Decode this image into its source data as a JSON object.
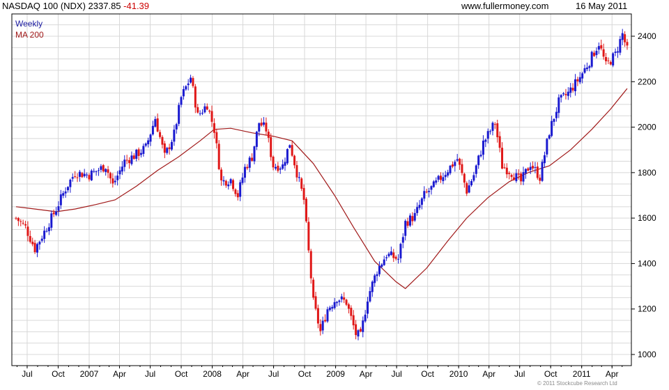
{
  "header": {
    "title": "NASDAQ 100 (NDX) 2337.85",
    "change": "-41.39",
    "website": "www.fullermoney.com",
    "date": "16 May 2011"
  },
  "legend": {
    "weekly": "Weekly",
    "ma": "MA 200"
  },
  "copyright": "© 2011 Stockcube Research Ltd",
  "colors": {
    "up": "#1a1ad0",
    "down": "#e01818",
    "ma": "#a01818",
    "grid": "#d8d8d8",
    "axis": "#000000"
  },
  "chart_data": {
    "type": "candlestick",
    "interval": "weekly",
    "x_range": [
      "2006-05-29",
      "2011-05-16"
    ],
    "ylim": [
      970,
      2450
    ],
    "y_ticks": [
      1000,
      1200,
      1400,
      1600,
      1800,
      2000,
      2200,
      2400
    ],
    "x_ticks": [
      {
        "label": "Jul",
        "date": "2006-07-01"
      },
      {
        "label": "Oct",
        "date": "2006-10-01"
      },
      {
        "label": "2007",
        "date": "2007-01-01"
      },
      {
        "label": "Apr",
        "date": "2007-04-01"
      },
      {
        "label": "Jul",
        "date": "2007-07-01"
      },
      {
        "label": "Oct",
        "date": "2007-10-01"
      },
      {
        "label": "2008",
        "date": "2008-01-01"
      },
      {
        "label": "Apr",
        "date": "2008-04-01"
      },
      {
        "label": "Jul",
        "date": "2008-07-01"
      },
      {
        "label": "Oct",
        "date": "2008-10-01"
      },
      {
        "label": "2009",
        "date": "2009-01-01"
      },
      {
        "label": "Apr",
        "date": "2009-04-01"
      },
      {
        "label": "Jul",
        "date": "2009-07-01"
      },
      {
        "label": "Oct",
        "date": "2009-10-01"
      },
      {
        "label": "2010",
        "date": "2010-01-01"
      },
      {
        "label": "Apr",
        "date": "2010-04-01"
      },
      {
        "label": "Jul",
        "date": "2010-07-01"
      },
      {
        "label": "Oct",
        "date": "2010-10-01"
      },
      {
        "label": "2011",
        "date": "2011-01-01"
      },
      {
        "label": "Apr",
        "date": "2011-04-01"
      }
    ],
    "grid": true,
    "price_path": [
      [
        "2006-05-29",
        1600
      ],
      [
        "2006-06-26",
        1560
      ],
      [
        "2006-07-24",
        1465
      ],
      [
        "2006-08-21",
        1540
      ],
      [
        "2006-09-25",
        1640
      ],
      [
        "2006-10-23",
        1730
      ],
      [
        "2006-11-20",
        1800
      ],
      [
        "2007-01-01",
        1790
      ],
      [
        "2007-02-19",
        1830
      ],
      [
        "2007-03-12",
        1745
      ],
      [
        "2007-04-16",
        1850
      ],
      [
        "2007-05-21",
        1880
      ],
      [
        "2007-06-18",
        1910
      ],
      [
        "2007-07-16",
        2040
      ],
      [
        "2007-08-13",
        1870
      ],
      [
        "2007-09-10",
        1970
      ],
      [
        "2007-10-01",
        2130
      ],
      [
        "2007-10-29",
        2220
      ],
      [
        "2007-11-19",
        2050
      ],
      [
        "2007-12-17",
        2100
      ],
      [
        "2008-01-07",
        1990
      ],
      [
        "2008-01-28",
        1760
      ],
      [
        "2008-02-25",
        1770
      ],
      [
        "2008-03-17",
        1700
      ],
      [
        "2008-04-07",
        1820
      ],
      [
        "2008-04-28",
        1870
      ],
      [
        "2008-05-19",
        2020
      ],
      [
        "2008-06-09",
        1990
      ],
      [
        "2008-06-30",
        1830
      ],
      [
        "2008-07-28",
        1830
      ],
      [
        "2008-08-18",
        1930
      ],
      [
        "2008-09-08",
        1800
      ],
      [
        "2008-09-29",
        1680
      ],
      [
        "2008-10-13",
        1450
      ],
      [
        "2008-10-27",
        1230
      ],
      [
        "2008-11-17",
        1100
      ],
      [
        "2008-12-08",
        1200
      ],
      [
        "2009-01-05",
        1250
      ],
      [
        "2009-02-02",
        1230
      ],
      [
        "2009-03-02",
        1090
      ],
      [
        "2009-03-16",
        1080
      ],
      [
        "2009-04-06",
        1250
      ],
      [
        "2009-05-04",
        1370
      ],
      [
        "2009-06-01",
        1440
      ],
      [
        "2009-07-06",
        1420
      ],
      [
        "2009-07-27",
        1580
      ],
      [
        "2009-08-24",
        1610
      ],
      [
        "2009-09-21",
        1700
      ],
      [
        "2009-10-19",
        1740
      ],
      [
        "2009-11-16",
        1790
      ],
      [
        "2009-12-28",
        1860
      ],
      [
        "2010-01-25",
        1720
      ],
      [
        "2010-02-15",
        1790
      ],
      [
        "2010-03-15",
        1930
      ],
      [
        "2010-04-19",
        2020
      ],
      [
        "2010-05-10",
        1830
      ],
      [
        "2010-06-07",
        1800
      ],
      [
        "2010-07-05",
        1760
      ],
      [
        "2010-08-02",
        1840
      ],
      [
        "2010-08-30",
        1780
      ],
      [
        "2010-09-27",
        1980
      ],
      [
        "2010-10-25",
        2110
      ],
      [
        "2010-11-22",
        2150
      ],
      [
        "2010-12-27",
        2220
      ],
      [
        "2011-01-24",
        2290
      ],
      [
        "2011-02-21",
        2370
      ],
      [
        "2011-03-14",
        2270
      ],
      [
        "2011-04-11",
        2320
      ],
      [
        "2011-05-02",
        2410
      ],
      [
        "2011-05-16",
        2338
      ]
    ],
    "ma200": [
      [
        "2006-05-29",
        1650
      ],
      [
        "2006-07-24",
        1640
      ],
      [
        "2006-09-25",
        1628
      ],
      [
        "2006-11-20",
        1640
      ],
      [
        "2007-01-22",
        1660
      ],
      [
        "2007-03-19",
        1680
      ],
      [
        "2007-05-21",
        1740
      ],
      [
        "2007-07-23",
        1810
      ],
      [
        "2007-09-24",
        1870
      ],
      [
        "2007-11-26",
        1940
      ],
      [
        "2008-01-07",
        1990
      ],
      [
        "2008-02-25",
        1995
      ],
      [
        "2008-04-28",
        1975
      ],
      [
        "2008-06-30",
        1960
      ],
      [
        "2008-08-25",
        1940
      ],
      [
        "2008-10-27",
        1840
      ],
      [
        "2008-12-29",
        1700
      ],
      [
        "2009-02-23",
        1560
      ],
      [
        "2009-04-27",
        1410
      ],
      [
        "2009-06-29",
        1320
      ],
      [
        "2009-07-27",
        1290
      ],
      [
        "2009-09-28",
        1380
      ],
      [
        "2009-11-30",
        1500
      ],
      [
        "2010-01-25",
        1600
      ],
      [
        "2010-03-29",
        1690
      ],
      [
        "2010-05-31",
        1760
      ],
      [
        "2010-07-26",
        1800
      ],
      [
        "2010-09-27",
        1830
      ],
      [
        "2010-11-29",
        1900
      ],
      [
        "2011-01-31",
        1990
      ],
      [
        "2011-03-28",
        2080
      ],
      [
        "2011-05-16",
        2170
      ]
    ]
  }
}
